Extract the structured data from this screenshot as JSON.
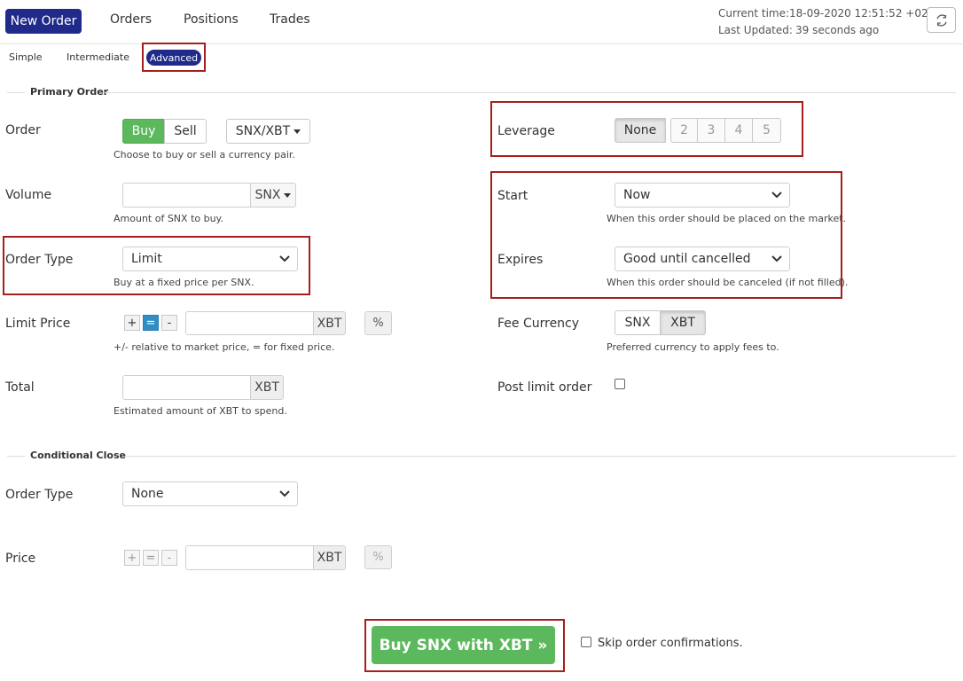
{
  "nav": {
    "tabs": [
      "New Order",
      "Orders",
      "Positions",
      "Trades"
    ],
    "current_time_label": "Current time:",
    "current_time_value": "18-09-2020 12:51:52 +02:00",
    "last_updated_label": "Last Updated:",
    "last_updated_value": "39 seconds ago"
  },
  "modes": [
    "Simple",
    "Intermediate",
    "Advanced"
  ],
  "primary": {
    "title": "Primary Order",
    "order_label": "Order",
    "buy_label": "Buy",
    "sell_label": "Sell",
    "pair": "SNX/XBT",
    "order_help": "Choose to buy or sell a currency pair.",
    "volume_label": "Volume",
    "volume_value": "",
    "volume_currency": "SNX",
    "volume_help": "Amount of SNX to buy.",
    "order_type_label": "Order Type",
    "order_type_value": "Limit",
    "order_type_help": "Buy at a fixed price per SNX.",
    "limit_price_label": "Limit Price",
    "plus": "+",
    "equals": "=",
    "minus": "-",
    "limit_price_value": "",
    "limit_price_currency": "XBT",
    "percent": "%",
    "limit_price_help": "+/- relative to market price, = for fixed price.",
    "total_label": "Total",
    "total_value": "",
    "total_currency": "XBT",
    "total_help": "Estimated amount of XBT to spend."
  },
  "right": {
    "leverage_label": "Leverage",
    "leverage_options": [
      "None",
      "2",
      "3",
      "4",
      "5"
    ],
    "start_label": "Start",
    "start_value": "Now",
    "start_help": "When this order should be placed on the market.",
    "expires_label": "Expires",
    "expires_value": "Good until cancelled",
    "expires_help": "When this order should be canceled (if not filled).",
    "fee_label": "Fee Currency",
    "fee_options": [
      "SNX",
      "XBT"
    ],
    "fee_help": "Preferred currency to apply fees to.",
    "post_limit_label": "Post limit order"
  },
  "conditional": {
    "title": "Conditional Close",
    "order_type_label": "Order Type",
    "order_type_value": "None",
    "price_label": "Price",
    "plus": "+",
    "equals": "=",
    "minus": "-",
    "price_value": "",
    "price_currency": "XBT",
    "percent": "%"
  },
  "footer": {
    "submit_label": "Buy SNX with XBT »",
    "skip_label": "Skip order confirmations."
  },
  "colors": {
    "brand": "#1f2a8a",
    "buy": "#5cb85c",
    "highlight": "#a4201d",
    "toggle_active": "#2f8fc4"
  }
}
